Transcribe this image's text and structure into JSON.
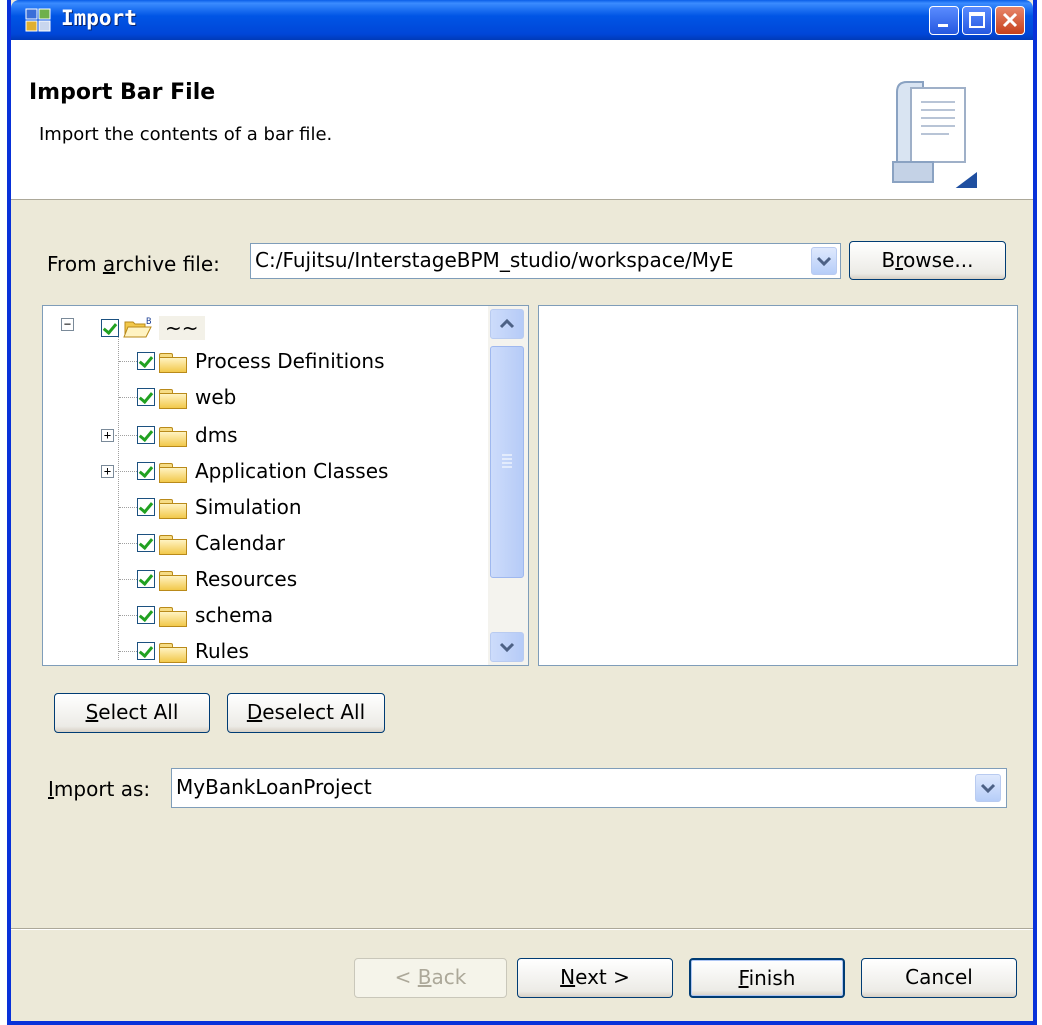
{
  "window": {
    "title": "Import"
  },
  "header": {
    "title": "Import Bar File",
    "description": "Import the contents of a bar file."
  },
  "archive": {
    "label_prefix": "From ",
    "label_accel": "a",
    "label_suffix": "rchive file:",
    "path": "C:/Fujitsu/InterstageBPM_studio/workspace/MyE",
    "browse_prefix": "B",
    "browse_accel": "r",
    "browse_suffix": "owse..."
  },
  "tree": {
    "root_label": "~~",
    "items": [
      {
        "label": "Process Definitions",
        "expandable": false
      },
      {
        "label": "web",
        "expandable": false
      },
      {
        "label": "dms",
        "expandable": true
      },
      {
        "label": "Application Classes",
        "expandable": true
      },
      {
        "label": "Simulation",
        "expandable": false
      },
      {
        "label": "Calendar",
        "expandable": false
      },
      {
        "label": "Resources",
        "expandable": false
      },
      {
        "label": "schema",
        "expandable": false
      },
      {
        "label": "Rules",
        "expandable": false
      }
    ]
  },
  "selection": {
    "select_all_accel": "S",
    "select_all_rest": "elect All",
    "deselect_all_accel": "D",
    "deselect_all_rest": "eselect All"
  },
  "import_as": {
    "label_accel": "I",
    "label_rest": "mport as:",
    "value": "MyBankLoanProject"
  },
  "footer": {
    "back_prefix": "< ",
    "back_accel": "B",
    "back_rest": "ack",
    "next_accel": "N",
    "next_rest": "ext >",
    "finish_accel": "F",
    "finish_rest": "inish",
    "cancel": "Cancel"
  },
  "colors": {
    "titlebar": "#0055e5",
    "dialog_bg": "#ece9d8",
    "input_border": "#7f9db9"
  }
}
